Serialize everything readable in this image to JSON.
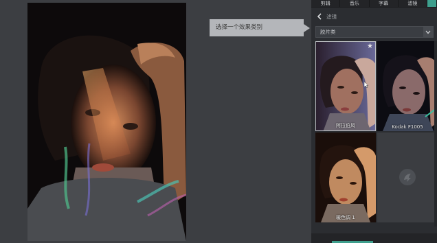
{
  "tooltip": {
    "text": "选择一个效果类别"
  },
  "tabs": [
    {
      "label": "剪辑"
    },
    {
      "label": "音乐"
    },
    {
      "label": "字幕"
    },
    {
      "label": "滤镜"
    },
    {
      "label": ""
    }
  ],
  "panel": {
    "title": "滤镜",
    "back_icon": "chevron-left-icon"
  },
  "category_dropdown": {
    "value": "胶片类"
  },
  "effects": [
    {
      "label": "阿拉伯风",
      "favorite": true
    },
    {
      "label": "Kodak F1005",
      "favorite": false
    },
    {
      "label": "暖色调 1",
      "favorite": false
    },
    {
      "label": "",
      "placeholder": true
    }
  ],
  "colors": {
    "accent": "#3e9f8d",
    "panel_bg": "#2b2d31",
    "canvas_bg": "#3c3e42"
  }
}
